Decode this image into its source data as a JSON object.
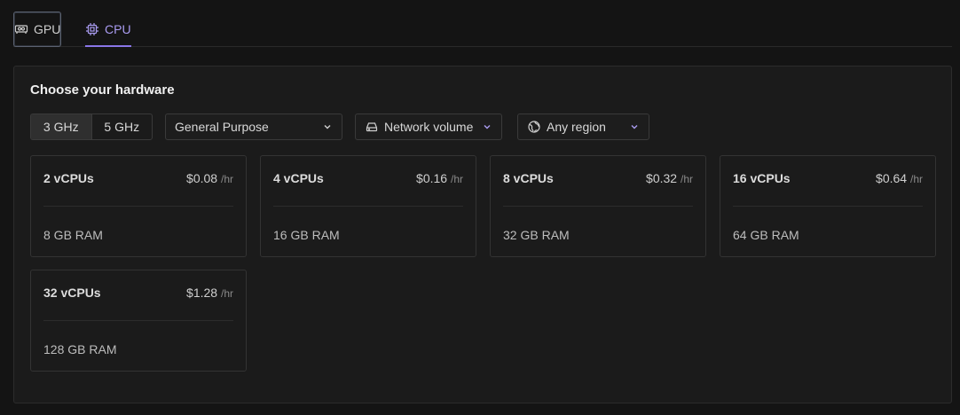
{
  "tabs": [
    {
      "label": "GPU",
      "icon": "gpu-card-icon",
      "active": false
    },
    {
      "label": "CPU",
      "icon": "cpu-chip-icon",
      "active": true
    }
  ],
  "panel": {
    "title": "Choose your hardware",
    "clock_options": [
      {
        "label": "3 GHz",
        "active": true
      },
      {
        "label": "5 GHz",
        "active": false
      }
    ],
    "purpose_select": {
      "value": "General Purpose"
    },
    "volume_select": {
      "value": "Network volume",
      "icon": "drive-icon"
    },
    "region_select": {
      "value": "Any region",
      "icon": "globe-icon"
    },
    "per_unit": "/hr",
    "cards": [
      {
        "name": "2 vCPUs",
        "price": "$0.08",
        "ram": "8 GB RAM"
      },
      {
        "name": "4 vCPUs",
        "price": "$0.16",
        "ram": "16 GB RAM"
      },
      {
        "name": "8 vCPUs",
        "price": "$0.32",
        "ram": "32 GB RAM"
      },
      {
        "name": "16 vCPUs",
        "price": "$0.64",
        "ram": "64 GB RAM"
      },
      {
        "name": "32 vCPUs",
        "price": "$1.28",
        "ram": "128 GB RAM"
      }
    ]
  },
  "colors": {
    "background": "#141414",
    "panel": "#1b1b1b",
    "accent": "#8a76e8",
    "accent_text": "#a99bf0"
  }
}
